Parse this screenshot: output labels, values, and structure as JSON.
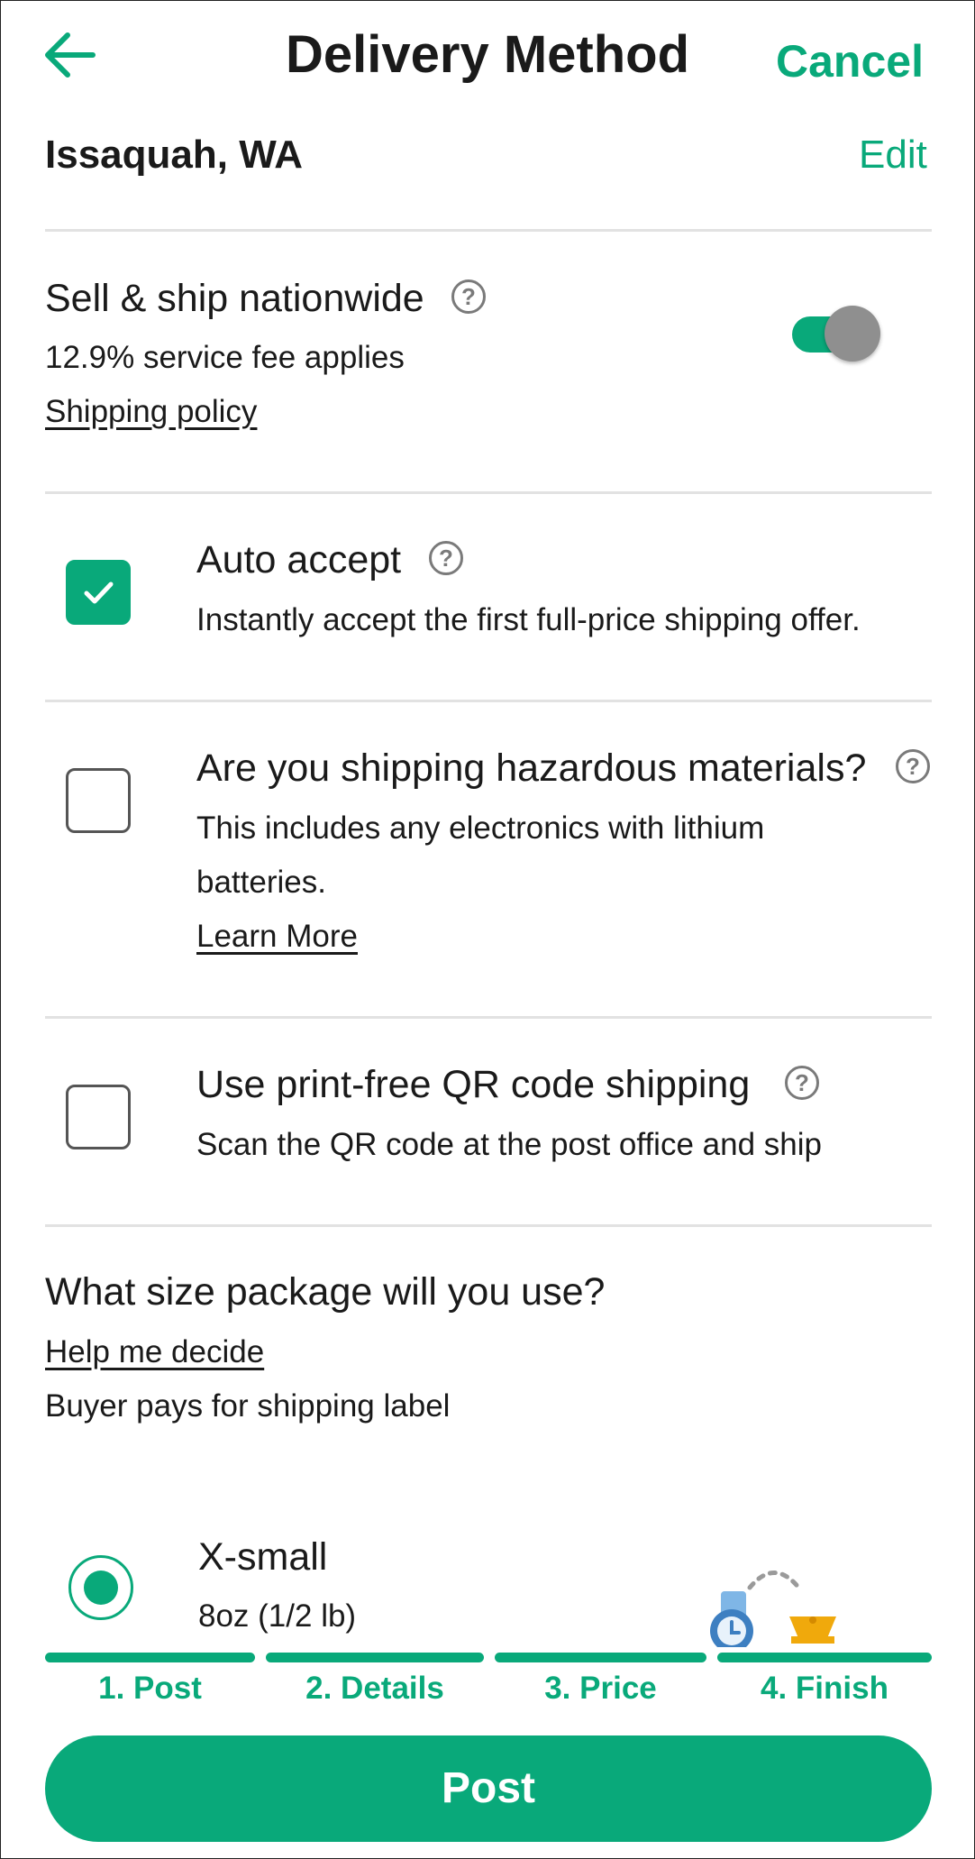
{
  "header": {
    "title": "Delivery Method",
    "cancel_label": "Cancel",
    "location": "Issaquah, WA",
    "edit_label": "Edit"
  },
  "nationwide": {
    "title": "Sell & ship nationwide",
    "fee_text": "12.9% service fee applies",
    "policy_link": "Shipping policy",
    "toggle_on": true
  },
  "options": [
    {
      "title": "Auto accept",
      "desc": "Instantly accept the first full-price shipping offer.",
      "checked": true
    },
    {
      "title": "Are you shipping hazardous materials?",
      "desc_line1": "This includes any electronics with lithium",
      "desc_line2": "batteries.",
      "link": "Learn More",
      "checked": false
    },
    {
      "title": "Use print-free QR code shipping",
      "desc": "Scan the QR code at the post office and ship",
      "checked": false
    }
  ],
  "package": {
    "question": "What size package will you use?",
    "help_link": "Help me decide",
    "note": "Buyer pays for shipping label",
    "selected": {
      "name": "X-small",
      "weight": "8oz (1/2 lb)",
      "icon": "watch-and-bowl-illustration"
    }
  },
  "steps": [
    "1. Post",
    "2. Details",
    "3. Price",
    "4. Finish"
  ],
  "post_button": "Post",
  "colors": {
    "accent": "#09a97a",
    "toggle_knob": "#8f8f8f"
  }
}
